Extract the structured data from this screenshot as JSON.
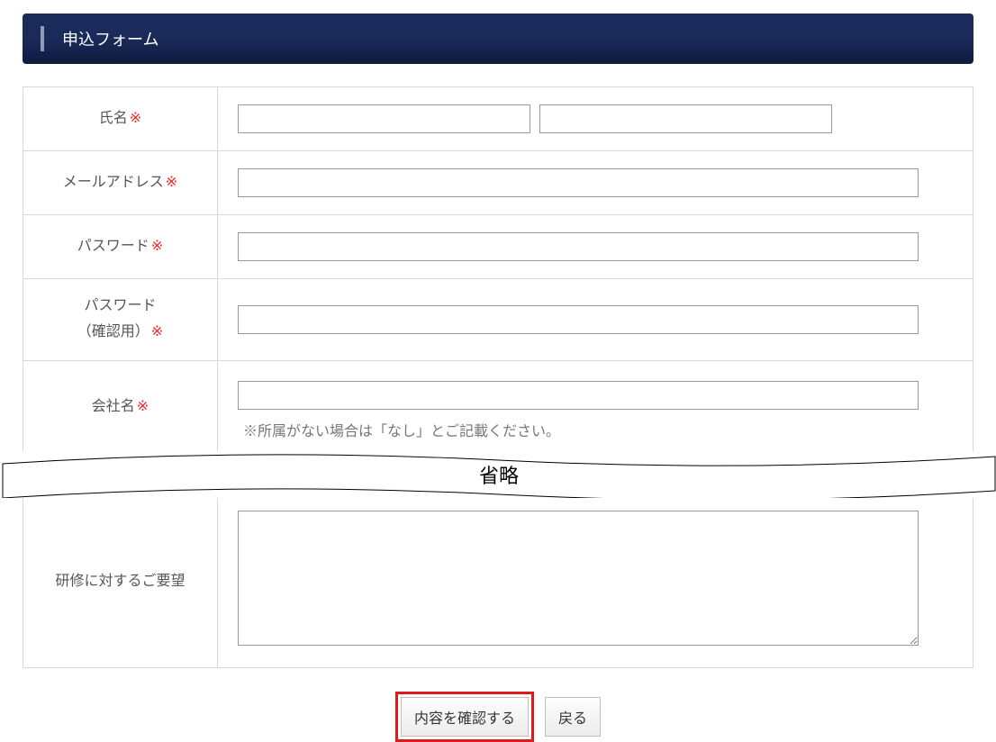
{
  "header": {
    "title": "申込フォーム"
  },
  "form": {
    "name": {
      "label": "氏名",
      "required_mark": "※",
      "value1": "",
      "value2": ""
    },
    "email": {
      "label": "メールアドレス",
      "required_mark": "※",
      "value": ""
    },
    "password": {
      "label": "パスワード",
      "required_mark": "※",
      "value": ""
    },
    "password_confirm": {
      "label_line1": "パスワード",
      "label_line2": "（確認用）",
      "required_mark": "※",
      "value": ""
    },
    "company": {
      "label": "会社名",
      "required_mark": "※",
      "value": "",
      "hint": "※所属がない場合は「なし」とご記載ください。"
    },
    "omitted_text": "省略",
    "requests": {
      "label": "研修に対するご要望",
      "value": ""
    }
  },
  "buttons": {
    "confirm": "内容を確認する",
    "back": "戻る"
  }
}
